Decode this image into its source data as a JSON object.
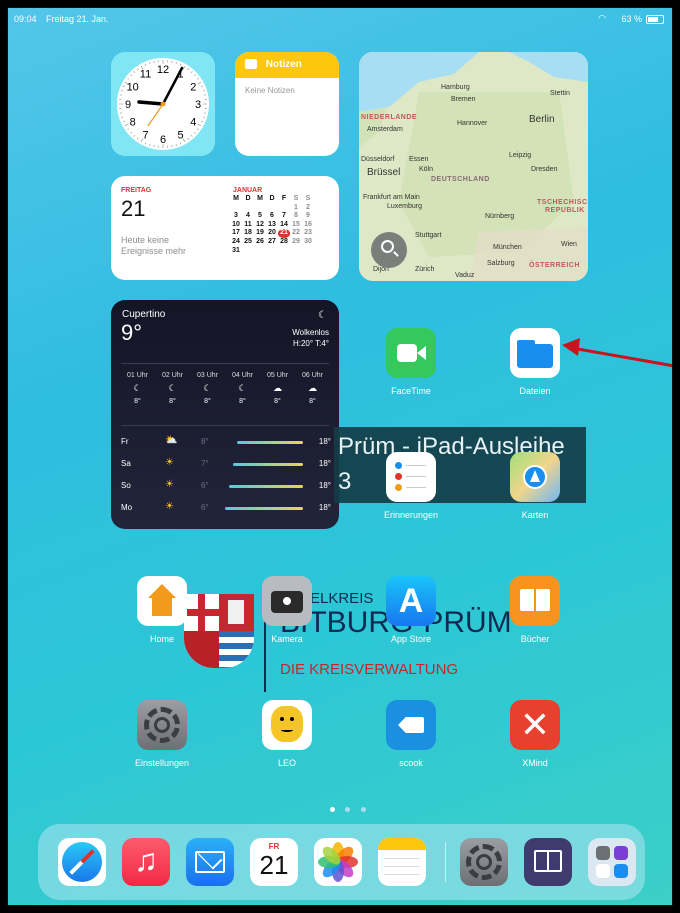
{
  "status_bar": {
    "time": "09:04",
    "date": "Freitag 21. Jan.",
    "battery": "63 %"
  },
  "clock_widget": {
    "numbers": [
      "12",
      "1",
      "2",
      "3",
      "4",
      "5",
      "6",
      "7",
      "8",
      "9",
      "10",
      "11"
    ]
  },
  "notes_widget": {
    "title": "Notizen",
    "empty_text": "Keine Notizen"
  },
  "map_widget": {
    "places": [
      {
        "name": "Hamburg"
      },
      {
        "name": "Bremen"
      },
      {
        "name": "Stettin"
      },
      {
        "name": "NIEDERLANDE"
      },
      {
        "name": "Amsterdam"
      },
      {
        "name": "Hannover"
      },
      {
        "name": "Berlin"
      },
      {
        "name": "Düsseldorf"
      },
      {
        "name": "Essen"
      },
      {
        "name": "Brüssel"
      },
      {
        "name": "Köln"
      },
      {
        "name": "Leipzig"
      },
      {
        "name": "Dresden"
      },
      {
        "name": "DEUTSCHLAND"
      },
      {
        "name": "Frankfurt am Main"
      },
      {
        "name": "Luxemburg"
      },
      {
        "name": "TSCHECHISCHE"
      },
      {
        "name": "REPUBLIK"
      },
      {
        "name": "Nürnberg"
      },
      {
        "name": "Stuttgart"
      },
      {
        "name": "München"
      },
      {
        "name": "Wien"
      },
      {
        "name": "Salzburg"
      },
      {
        "name": "ÖSTERREICH"
      },
      {
        "name": "Dijon"
      },
      {
        "name": "Zürich"
      },
      {
        "name": "Vaduz"
      }
    ]
  },
  "calendar_widget": {
    "weekday": "FREITAG",
    "day": "21",
    "no_events": "Heute keine",
    "no_events2": "Ereignisse mehr",
    "month": "JANUAR",
    "weekdays": [
      "M",
      "D",
      "M",
      "D",
      "F",
      "S",
      "S"
    ],
    "weeks": [
      [
        "",
        "",
        "",
        "",
        "",
        "1",
        "2"
      ],
      [
        "3",
        "4",
        "5",
        "6",
        "7",
        "8",
        "9"
      ],
      [
        "10",
        "11",
        "12",
        "13",
        "14",
        "15",
        "16"
      ],
      [
        "17",
        "18",
        "19",
        "20",
        "21",
        "22",
        "23"
      ],
      [
        "24",
        "25",
        "26",
        "27",
        "28",
        "29",
        "30"
      ],
      [
        "31",
        "",
        "",
        "",
        "",
        "",
        ""
      ]
    ],
    "today": "21"
  },
  "weather_widget": {
    "city": "Cupertino",
    "temp": "9°",
    "condition": "Wolkenlos",
    "hilo": "H:20° T:4°",
    "hours": [
      {
        "time": "01 Uhr",
        "temp": "8°"
      },
      {
        "time": "02 Uhr",
        "temp": "8°"
      },
      {
        "time": "03 Uhr",
        "temp": "8°"
      },
      {
        "time": "04 Uhr",
        "temp": "8°"
      },
      {
        "time": "05 Uhr",
        "temp": "8°"
      },
      {
        "time": "06 Uhr",
        "temp": "8°"
      }
    ],
    "days": [
      {
        "day": "Fr",
        "low": "8°",
        "high": "18°"
      },
      {
        "day": "Sa",
        "low": "7°",
        "high": "18°"
      },
      {
        "day": "So",
        "low": "6°",
        "high": "18°"
      },
      {
        "day": "Mo",
        "low": "6°",
        "high": "18°"
      }
    ]
  },
  "wallpaper": {
    "banner_text": "Prüm - iPad-Ausleihe",
    "banner_num": "3",
    "line1": "ELKREIS",
    "line2": "BITBURG-PRÜM",
    "line3": "DIE KREISVERWALTUNG"
  },
  "apps": {
    "facetime": "FaceTime",
    "dateien": "Dateien",
    "erinnerungen": "Erinnerungen",
    "karten": "Karten",
    "home": "Home",
    "kamera": "Kamera",
    "appstore": "App Store",
    "buecher": "Bücher",
    "einstellungen": "Einstellungen",
    "leo": "LEO",
    "scook": "scook",
    "xmind": "XMind"
  },
  "dock": {
    "calendar_weekday": "FR",
    "calendar_day": "21"
  },
  "colors": {
    "annotation_arrow": "#c8141c",
    "today_badge": "#e0332d"
  }
}
